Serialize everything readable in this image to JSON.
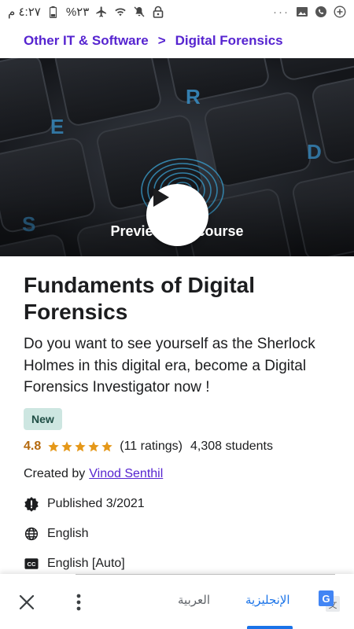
{
  "status_bar": {
    "time": "٤:٢٧ م",
    "battery": "%٢٣",
    "icons": [
      "battery-icon",
      "airplane-icon",
      "wifi-icon",
      "mute-icon",
      "lock-icon",
      "more-icon",
      "image-icon",
      "whatsapp-icon",
      "add-icon"
    ],
    "more_dots": "···"
  },
  "breadcrumb": {
    "items": [
      "Other IT & Software",
      "Digital Forensics"
    ],
    "separator": ">"
  },
  "hero": {
    "preview_label": "Preview this course",
    "key_letters": [
      "R",
      "E",
      "D",
      "S"
    ]
  },
  "course": {
    "title": "Fundaments of Digital Forensics",
    "headline": "Do you want to see yourself as the Sherlock Holmes in this digital era, become a Digital Forensics Investigator now !",
    "badge": "New",
    "rating": "4.8",
    "stars": 5,
    "ratings_count": "(11 ratings)",
    "students": "4,308 students",
    "created_by_label": "Created by",
    "instructor": "Vinod Senthil",
    "published": "Published 3/2021",
    "language": "English",
    "captions": "English [Auto]"
  },
  "translate_bar": {
    "lang_source": "العربية",
    "lang_target": "الإنجليزية",
    "close_icon": "close-icon",
    "menu_icon": "more-vert-icon",
    "translate_icon": "google-translate-icon"
  },
  "colors": {
    "accent": "#5624d0",
    "rating": "#b4690e",
    "star": "#e59819",
    "badge_bg": "#cde6e1",
    "translate_blue": "#1a73e8"
  }
}
